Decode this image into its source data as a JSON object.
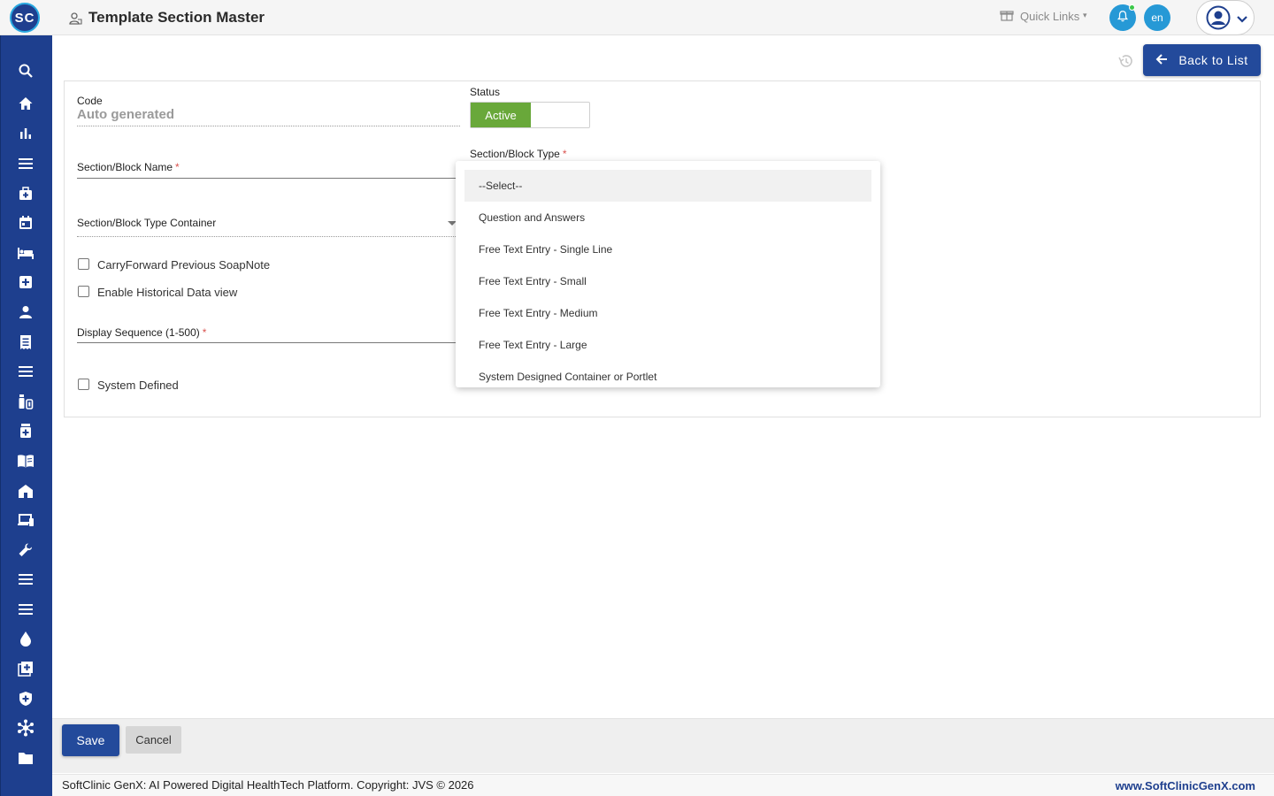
{
  "header": {
    "logo_text": "SC",
    "title": "Template Section Master",
    "quick_links": "Quick Links",
    "language": "en",
    "brand_color": "#1e3f8e",
    "accent_color": "#2699d6"
  },
  "sidebar": {
    "icons": [
      "search-icon",
      "home-icon",
      "bar-chart-icon",
      "menu-icon",
      "medical-bag-icon",
      "calendar-icon",
      "bed-icon",
      "medical-plus-icon",
      "person-icon",
      "receipt-icon",
      "list-icon",
      "medication-icon",
      "pharmacy-icon",
      "book-icon",
      "building-icon",
      "devices-icon",
      "wrench-icon",
      "list-icon",
      "list-icon",
      "drop-icon",
      "add-box-icon",
      "shield-icon",
      "hub-icon",
      "folder-icon"
    ]
  },
  "toolbar": {
    "back_label": "Back to List"
  },
  "form": {
    "code_label": "Code",
    "code_value": "Auto generated",
    "status_label": "Status",
    "status_value": "Active",
    "section_name_label": "Section/Block Name",
    "section_type_label": "Section/Block Type",
    "container_label": "Section/Block Type Container",
    "carry_forward_label": "CarryForward Previous SoapNote",
    "historical_label": "Enable Historical Data view",
    "display_sequence_label": "Display Sequence (1-500)",
    "system_defined_label": "System Defined",
    "required_mark": "*"
  },
  "dropdown": {
    "selected": "--Select--",
    "options": [
      "--Select--",
      "Question and Answers",
      "Free Text Entry - Single Line",
      "Free Text Entry - Small",
      "Free Text Entry - Medium",
      "Free Text Entry - Large",
      "System Designed Container or Portlet"
    ]
  },
  "actions": {
    "save_label": "Save",
    "cancel_label": "Cancel"
  },
  "footer": {
    "copyright": "SoftClinic GenX: AI Powered Digital HealthTech Platform. Copyright: JVS © 2026",
    "website": "www.SoftClinicGenX.com"
  }
}
